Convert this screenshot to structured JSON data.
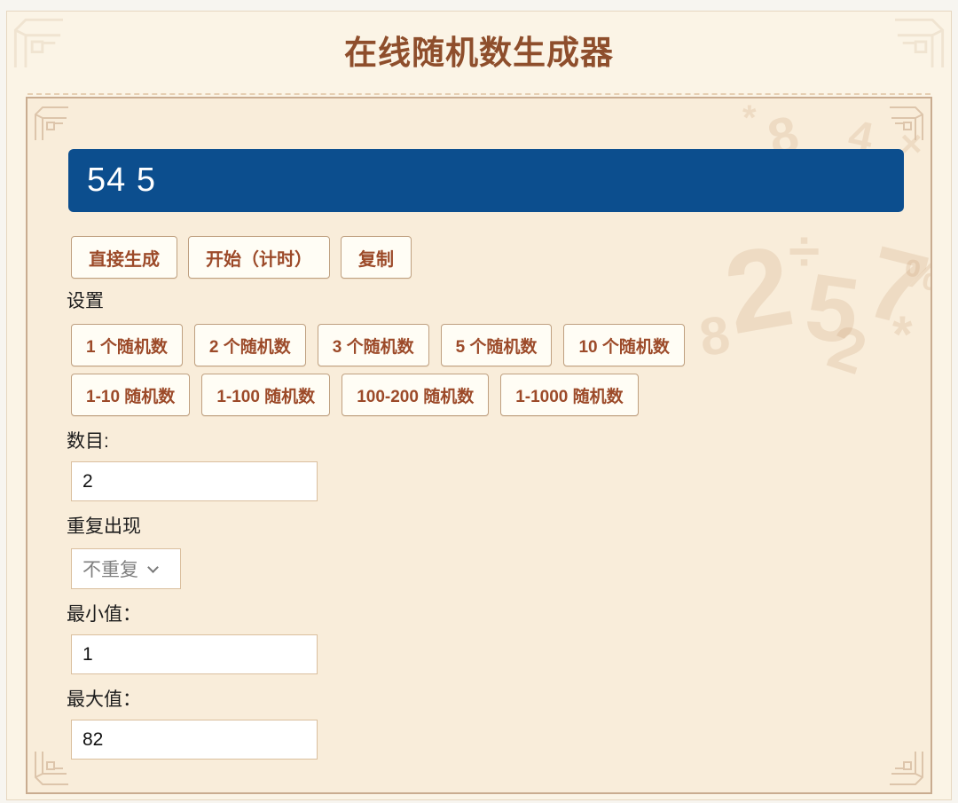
{
  "page": {
    "title": "在线随机数生成器"
  },
  "result": {
    "value": "54 5"
  },
  "actions": {
    "generate": "直接生成",
    "start_timed": "开始（计时）",
    "copy": "复制"
  },
  "settings": {
    "label": "设置",
    "preset_counts": [
      "1 个随机数",
      "2 个随机数",
      "3 个随机数",
      "5 个随机数",
      "10 个随机数"
    ],
    "preset_ranges": [
      "1-10 随机数",
      "1-100 随机数",
      "100-200 随机数",
      "1-1000 随机数"
    ],
    "count": {
      "label": "数目:",
      "value": "2"
    },
    "repeat": {
      "label": "重复出现",
      "value": "不重复"
    },
    "min": {
      "label": "最小值：",
      "value": "1"
    },
    "max": {
      "label": "最大值：",
      "value": "82"
    }
  },
  "watermark": {
    "glyphs": [
      "*",
      "8",
      "4",
      "×",
      "÷",
      "2",
      "5",
      "7",
      "2",
      "*",
      "8",
      "%"
    ]
  },
  "colors": {
    "result_bar": "#0c4e8e",
    "title_brown": "#8e4e2c",
    "button_text": "#9c4a29",
    "panel_bg": "#f9edda",
    "outer_bg": "#fbf4e6"
  }
}
